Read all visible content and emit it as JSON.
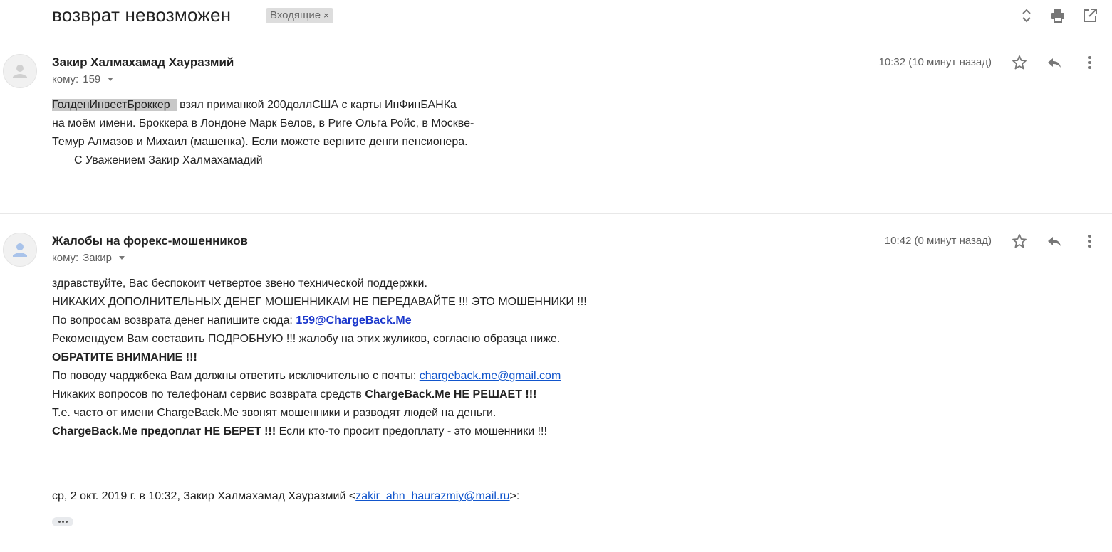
{
  "thread": {
    "subject": "возврат невозможен",
    "label": "Входящие",
    "label_remove": "×"
  },
  "toolbar_icons": [
    "expand-collapse-icon",
    "print-icon",
    "open-in-new-window-icon"
  ],
  "messages": [
    {
      "sender": "Закир Халмахамад Хауразмий",
      "to_prefix": "кому:",
      "to": "159",
      "time": "10:32 (10 минут назад)",
      "body": {
        "line1_highlight": "ГолденИнвестБроккер",
        "line1_rest": " взял приманкой 200доллСША с карты ИнФинБАНКа",
        "line2": "на моём имени. Броккера в Лондоне Марк Белов, в Риге Ольга Ройс, в Москве-",
        "line3": "Темур Алмазов и Михаил (машенка).  Если можете верните денги пенсионера.",
        "line4": "С Уважением Закир Халмахамадий"
      }
    },
    {
      "sender": "Жалобы на форекс-мошенников",
      "to_prefix": "кому:",
      "to": "Закир",
      "time": "10:42 (0 минут назад)",
      "body": {
        "l1": "здравствуйте, Вас беспокоит четвертое звено технической поддержки.",
        "l2": "НИКАКИХ ДОПОЛНИТЕЛЬНЫХ ДЕНЕГ МОШЕННИКАМ НЕ ПЕРЕДАВАЙТЕ !!! ЭТО МОШЕННИКИ !!!",
        "l3_text": "По вопросам возврата денег напишите сюда: ",
        "l3_link": "159@ChargeBack.Me",
        "l4": "Рекомендуем Вам составить ПОДРОБНУЮ !!! жалобу на этих жуликов, согласно образца ниже.",
        "l5": "ОБРАТИТЕ ВНИМАНИЕ !!!",
        "l6_text": "По поводу чарджбека Вам должны ответить исключительно с почты: ",
        "l6_link": "chargeback.me@gmail.com",
        "l7_text": "Никаких вопросов по телефонам сервис возврата средств ",
        "l7_bold": "ChargeBack.Me НЕ РЕШАЕТ !!!",
        "l8": "Т.е. часто от имени ChargeBack.Me звонят мошенники и разводят людей на деньги.",
        "l9_bold": "ChargeBack.Me предоплат НЕ БЕРЕТ !!!",
        "l9_rest": " Если кто-то просит предоплату - это мошенники !!!",
        "quote_prefix": "ср, 2 окт. 2019 г. в 10:32, Закир Халмахамад Хауразмий <",
        "quote_email": "zakir_ahn_haurazmiy@mail.ru",
        "quote_suffix": ">:"
      }
    }
  ],
  "colors": {
    "link": "#1155cc",
    "link_bold": "#1a37cc",
    "highlight": "#c8c8c8",
    "chip": "#dddddd"
  }
}
